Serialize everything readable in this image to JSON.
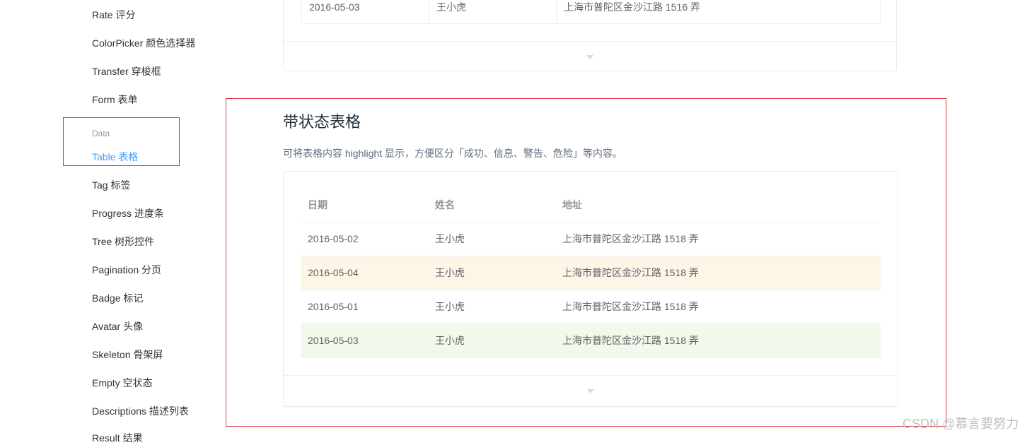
{
  "sidebar": {
    "items_before": [
      "Rate 评分",
      "ColorPicker 颜色选择器",
      "Transfer 穿梭框",
      "Form 表单"
    ],
    "group_label": "Data",
    "active_item": "Table 表格",
    "items_after": [
      "Tag 标签",
      "Progress 进度条",
      "Tree 树形控件",
      "Pagination 分页",
      "Badge 标记",
      "Avatar 头像",
      "Skeleton 骨架屏",
      "Empty 空状态",
      "Descriptions 描述列表",
      "Result 结果"
    ]
  },
  "top_demo": {
    "last_row": {
      "date": "2016-05-03",
      "name": "王小虎",
      "address": "上海市普陀区金沙江路 1516 弄"
    },
    "expand_icon": "caret-down-icon"
  },
  "section": {
    "title": "带状态表格",
    "description": "可将表格内容 highlight 显示，方便区分「成功、信息、警告、危险」等内容。"
  },
  "table": {
    "headers": {
      "date": "日期",
      "name": "姓名",
      "address": "地址"
    },
    "rows": [
      {
        "date": "2016-05-02",
        "name": "王小虎",
        "address": "上海市普陀区金沙江路 1518 弄",
        "status": "none"
      },
      {
        "date": "2016-05-04",
        "name": "王小虎",
        "address": "上海市普陀区金沙江路 1518 弄",
        "status": "warning"
      },
      {
        "date": "2016-05-01",
        "name": "王小虎",
        "address": "上海市普陀区金沙江路 1518 弄",
        "status": "none"
      },
      {
        "date": "2016-05-03",
        "name": "王小虎",
        "address": "上海市普陀区金沙江路 1518 弄",
        "status": "success"
      }
    ]
  },
  "colors": {
    "active": "#409eff",
    "warning_row": "#fdf5e6",
    "success_row": "#f0f9eb",
    "highlight_border": "#d9363e"
  },
  "watermark": "CSDN @慕言要努力"
}
